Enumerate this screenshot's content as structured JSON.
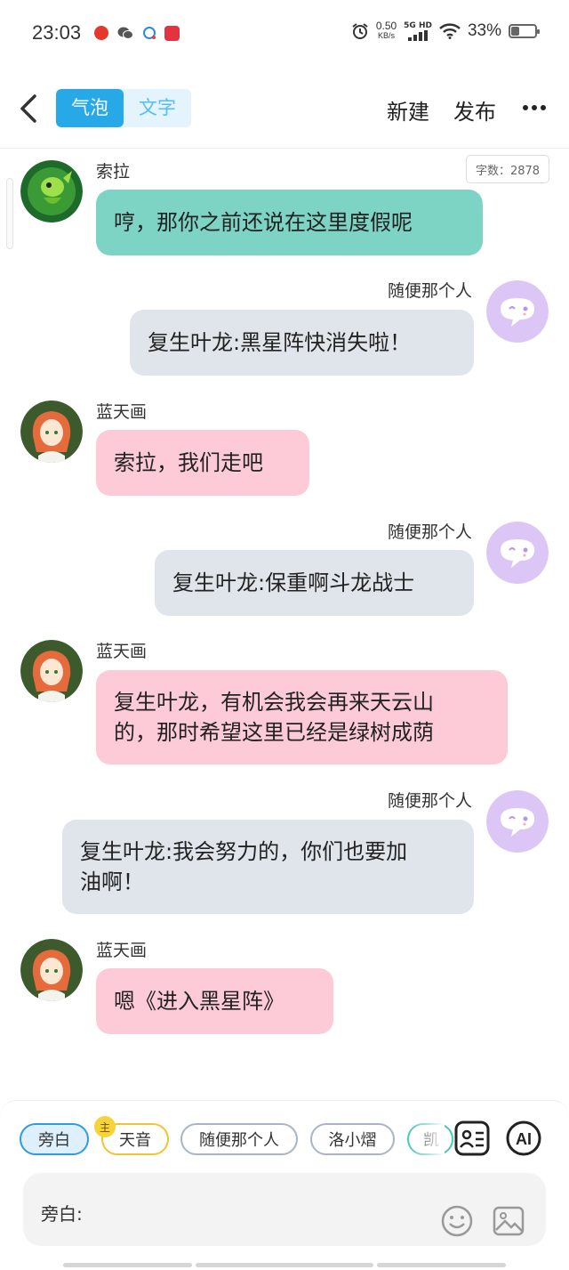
{
  "status_bar": {
    "time": "23:03",
    "speed_value": "0.50",
    "speed_unit": "KB/s",
    "network": "5G HD",
    "battery_percent": "33%",
    "battery_level": 0.33
  },
  "header": {
    "tab_bubble": "气泡",
    "tab_text": "文字",
    "new_label": "新建",
    "publish_label": "发布"
  },
  "word_count": "字数：2878",
  "messages": [
    {
      "name": "索拉",
      "text": "哼，那你之前还说在这里度假呢"
    },
    {
      "name": "随便那个人",
      "text": "复生叶龙:黑星阵快消失啦！"
    },
    {
      "name": "蓝天画",
      "text": "索拉，我们走吧"
    },
    {
      "name": "随便那个人",
      "text": "复生叶龙:保重啊斗龙战士"
    },
    {
      "name": "蓝天画",
      "text_line1": "复生叶龙，有机会我会再来天云山",
      "text_line2": "的，那时希望这里已经是绿树成荫"
    },
    {
      "name": "随便那个人",
      "text_line1": "复生叶龙:我会努力的，你们也要加",
      "text_line2": "油啊！"
    },
    {
      "name": "蓝天画",
      "text": "嗯《进入黑星阵》"
    }
  ],
  "characters": {
    "c0": "旁白",
    "c1": "天音",
    "c1_badge": "主",
    "c2": "随便那个人",
    "c3": "洛小熠",
    "c4": "凯"
  },
  "input": {
    "label": "旁白:"
  },
  "colors": {
    "accent": "#27a9e7",
    "bubble_teal": "#7dd3c4",
    "bubble_pink": "#fdcbd8",
    "bubble_gray": "#e0e5ec"
  }
}
